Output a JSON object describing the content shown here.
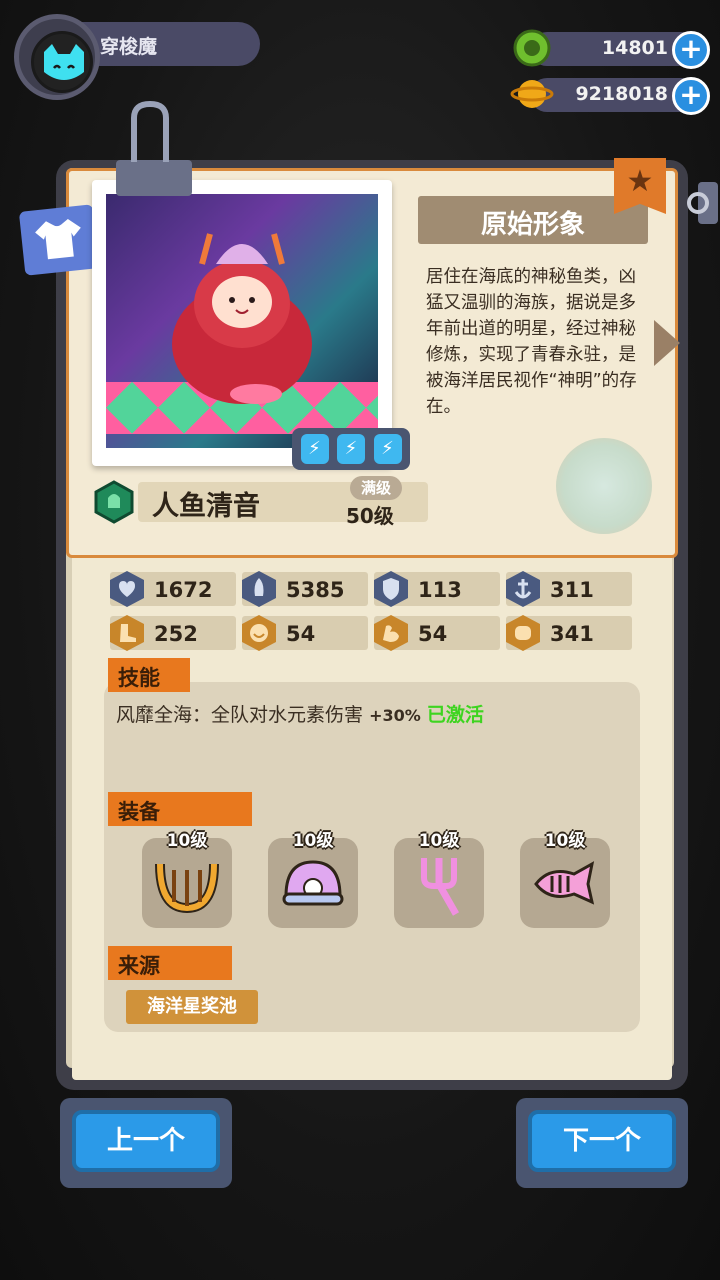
{
  "player": {
    "name": "穿梭魔"
  },
  "currencies": [
    {
      "icon": "green-gem-coin-icon",
      "value": "14801"
    },
    {
      "icon": "gold-planet-coin-icon",
      "value": "9218018"
    }
  ],
  "character": {
    "title": "原始形象",
    "name": "人鱼清音",
    "max_badge": "满级",
    "level": "50级",
    "description": "居住在海底的神秘鱼类，凶猛又温驯的海族，据说是多年前出道的明星，经过神秘修炼，实现了青春永驻，是被海洋居民视作“神明”的存在。",
    "energy": [
      "⚡",
      "⚡",
      "⚡"
    ]
  },
  "stats": [
    {
      "icon": "heart-shield-icon",
      "value": "1672"
    },
    {
      "icon": "rocket-icon",
      "value": "5385"
    },
    {
      "icon": "shield-icon",
      "value": "113"
    },
    {
      "icon": "anchor-icon",
      "value": "311"
    },
    {
      "icon": "boot-icon",
      "value": "252"
    },
    {
      "icon": "smile-icon",
      "value": "54"
    },
    {
      "icon": "muscle-icon",
      "value": "54"
    },
    {
      "icon": "fist-icon",
      "value": "341"
    }
  ],
  "sections": {
    "skill": "技能",
    "equipment": "装备",
    "source": "来源"
  },
  "skill": {
    "text": "风靡全海：全队对水元素伤害",
    "bonus": "+30%",
    "status": "已激活"
  },
  "equipment": [
    {
      "icon": "lyre-icon",
      "level": "10级"
    },
    {
      "icon": "pearl-shell-icon",
      "level": "10级"
    },
    {
      "icon": "fork-icon",
      "level": "10级"
    },
    {
      "icon": "fish-bone-icon",
      "level": "10级"
    }
  ],
  "source": "海洋星奖池",
  "nav": {
    "prev": "上一个",
    "next": "下一个"
  },
  "colors": {
    "accent": "#e8781e",
    "button": "#2b9ae8",
    "active": "#3ed420"
  }
}
